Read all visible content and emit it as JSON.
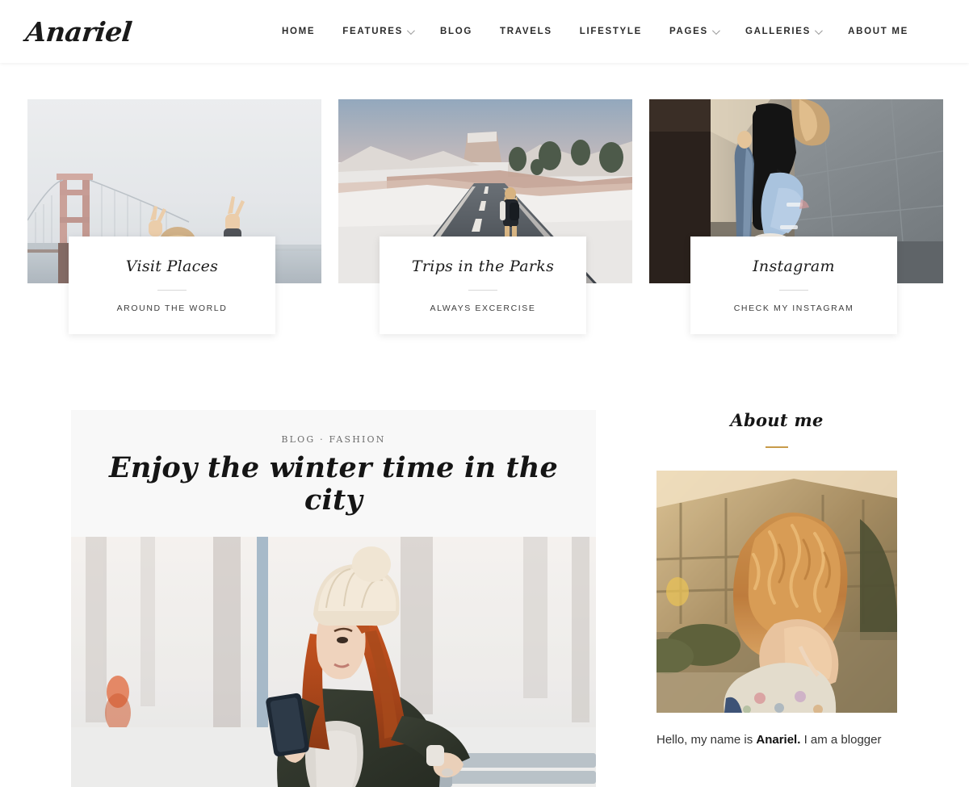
{
  "header": {
    "logo_text": "Anariel",
    "nav": [
      {
        "label": "HOME",
        "has_dropdown": false
      },
      {
        "label": "FEATURES",
        "has_dropdown": true
      },
      {
        "label": "BLOG",
        "has_dropdown": false
      },
      {
        "label": "TRAVELS",
        "has_dropdown": false
      },
      {
        "label": "LIFESTYLE",
        "has_dropdown": false
      },
      {
        "label": "PAGES",
        "has_dropdown": true
      },
      {
        "label": "GALLERIES",
        "has_dropdown": true
      },
      {
        "label": "ABOUT ME",
        "has_dropdown": false
      }
    ]
  },
  "promo_cards": [
    {
      "title": "Visit Places",
      "subtitle": "AROUND THE WORLD",
      "image_alt": "golden-gate-bridge-in-fog-with-raised-hands-making-peace-signs"
    },
    {
      "title": "Trips in the Parks",
      "subtitle": "ALWAYS EXCERCISE",
      "image_alt": "snowy-desert-highway-with-person-walking-toward-mesa"
    },
    {
      "title": "Instagram",
      "subtitle": "CHECK MY INSTAGRAM",
      "image_alt": "person-in-ripped-jeans-leaning-against-concrete-wall"
    }
  ],
  "post": {
    "categories": "BLOG · FASHION",
    "title": "Enjoy the winter time in the city",
    "image_alt": "woman-in-cream-beanie-and-green-coat-using-phone-on-snowy-park-bench"
  },
  "about": {
    "heading": "About me",
    "image_alt": "back-view-of-woman-with-curly-auburn-hair-in-golden-hour-light",
    "bio_before": "Hello, my name is ",
    "bio_name": "Anariel.",
    "bio_after": " I am a blogger"
  },
  "colors": {
    "accent_gold": "#c89b4a",
    "text_dark": "#151515",
    "text_muted": "#6d6d6d",
    "panel_bg": "#f8f8f8",
    "page_bg": "#ffffff"
  },
  "icons": {
    "chevron_down": "chevron-down-icon"
  }
}
